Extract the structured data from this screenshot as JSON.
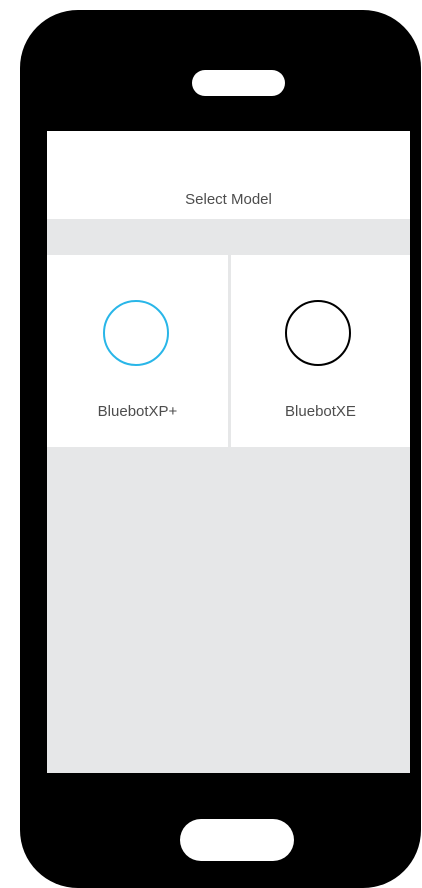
{
  "header": {
    "title": "Select Model"
  },
  "models": [
    {
      "label": "BluebotXP+",
      "icon": "circle-outline-icon",
      "selected": true,
      "color": "#29b6e8"
    },
    {
      "label": "BluebotXE",
      "icon": "circle-outline-icon",
      "selected": false,
      "color": "#000000"
    }
  ],
  "colors": {
    "accent": "#29b6e8",
    "screen_background": "#e6e7e8",
    "device_body": "#000000"
  }
}
